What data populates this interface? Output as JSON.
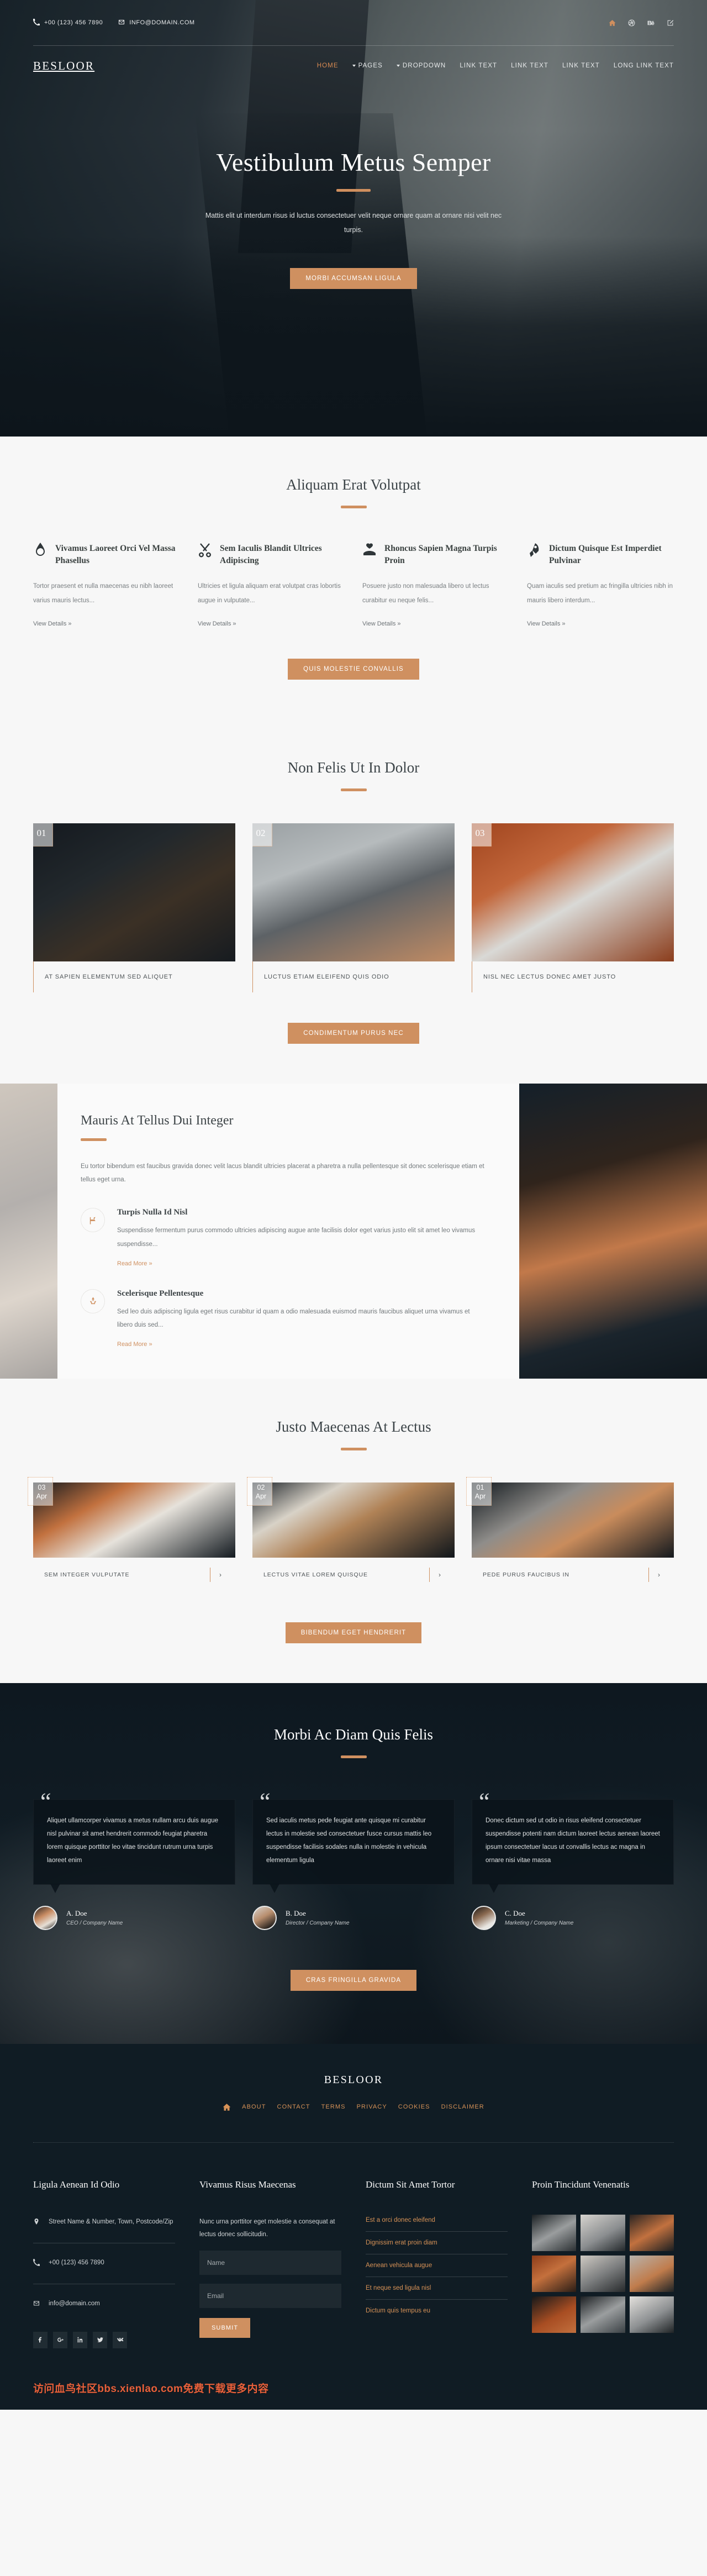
{
  "topbar": {
    "phone": "+00 (123) 456 7890",
    "email": "INFO@DOMAIN.COM",
    "socials": [
      "home-icon",
      "dribbble-icon",
      "behance-icon",
      "edit-icon"
    ]
  },
  "header": {
    "brand": "BESLOOR",
    "nav": [
      {
        "label": "HOME",
        "active": true,
        "caret": false
      },
      {
        "label": "PAGES",
        "active": false,
        "caret": true
      },
      {
        "label": "DROPDOWN",
        "active": false,
        "caret": true
      },
      {
        "label": "LINK TEXT",
        "active": false,
        "caret": false
      },
      {
        "label": "LINK TEXT",
        "active": false,
        "caret": false
      },
      {
        "label": "LINK TEXT",
        "active": false,
        "caret": false
      },
      {
        "label": "LONG LINK TEXT",
        "active": false,
        "caret": false
      }
    ]
  },
  "hero": {
    "title": "Vestibulum Metus Semper",
    "subtitle": "Mattis elit ut interdum risus id luctus consectetuer velit neque ornare quam at ornare nisi velit nec turpis.",
    "cta": "MORBI ACCUMSAN LIGULA"
  },
  "services": {
    "title": "Aliquam Erat Volutpat",
    "cta": "QUIS MOLESTIE CONVALLIS",
    "items": [
      {
        "icon": "pen-nib-icon",
        "title": "Vivamus Laoreet Orci Vel Massa Phasellus",
        "text": "Tortor praesent et nulla maecenas eu nibh laoreet varius mauris lectus...",
        "link": "View Details »"
      },
      {
        "icon": "scissors-icon",
        "title": "Sem Iaculis Blandit Ultrices Adipiscing",
        "text": "Ultricies et ligula aliquam erat volutpat cras lobortis augue in vulputate...",
        "link": "View Details »"
      },
      {
        "icon": "heart-hand-icon",
        "title": "Rhoncus Sapien Magna Turpis Proin",
        "text": "Posuere justo non malesuada libero ut lectus curabitur eu neque felis...",
        "link": "View Details »"
      },
      {
        "icon": "rocket-icon",
        "title": "Dictum Quisque Est Imperdiet Pulvinar",
        "text": "Quam iaculis sed pretium ac fringilla ultricies nibh in mauris libero interdum...",
        "link": "View Details »"
      }
    ]
  },
  "portfolio": {
    "title": "Non Felis Ut In Dolor",
    "cta": "CONDIMENTUM PURUS NEC",
    "items": [
      {
        "number": "01",
        "caption": "AT SAPIEN ELEMENTUM SED ALIQUET"
      },
      {
        "number": "02",
        "caption": "LUCTUS ETIAM ELEIFEND QUIS ODIO"
      },
      {
        "number": "03",
        "caption": "NISL NEC LECTUS DONEC AMET JUSTO"
      }
    ]
  },
  "feature": {
    "title": "Mauris At Tellus Dui Integer",
    "text": "Eu tortor bibendum est faucibus gravida donec velit lacus blandit ultricies placerat a pharetra a nulla pellentesque sit donec scelerisque etiam et tellus eget urna.",
    "items": [
      {
        "icon": "flag-icon",
        "title": "Turpis Nulla Id Nisl",
        "text": "Suspendisse fermentum purus commodo ultricies adipiscing augue ante facilisis dolor eget varius justo elit sit amet leo vivamus suspendisse...",
        "link": "Read More »"
      },
      {
        "icon": "recycle-icon",
        "title": "Scelerisque Pellentesque",
        "text": "Sed leo duis adipiscing ligula eget risus curabitur id quam a odio malesuada euismod mauris faucibus aliquet urna vivamus et libero duis sed...",
        "link": "Read More »"
      }
    ]
  },
  "blog": {
    "title": "Justo Maecenas At Lectus",
    "cta": "BIBENDUM EGET HENDRERIT",
    "items": [
      {
        "day": "03",
        "month": "Apr",
        "caption": "SEM INTEGER VULPUTATE",
        "arrow": "›"
      },
      {
        "day": "02",
        "month": "Apr",
        "caption": "LECTUS VITAE LOREM QUISQUE",
        "arrow": "›"
      },
      {
        "day": "01",
        "month": "Apr",
        "caption": "PEDE PURUS FAUCIBUS IN",
        "arrow": "›"
      }
    ]
  },
  "testimonials": {
    "title": "Morbi Ac Diam Quis Felis",
    "cta": "CRAS FRINGILLA GRAVIDA",
    "items": [
      {
        "quote": "Aliquet ullamcorper vivamus a metus nullam arcu duis augue nisl pulvinar sit amet hendrerit commodo feugiat pharetra lorem quisque porttitor leo vitae tincidunt rutrum urna turpis laoreet enim",
        "name": "A. Doe",
        "role": "CEO / Company Name"
      },
      {
        "quote": "Sed iaculis metus pede feugiat ante quisque mi curabitur lectus in molestie sed consectetuer fusce cursus mattis leo suspendisse facilisis sodales nulla in molestie in vehicula elementum ligula",
        "name": "B. Doe",
        "role": "Director / Company Name"
      },
      {
        "quote": "Donec dictum sed ut odio in risus eleifend consectetuer suspendisse potenti nam dictum laoreet lectus aenean laoreet ipsum consectetuer lacus ut convallis lectus ac magna in ornare nisi vitae massa",
        "name": "C. Doe",
        "role": "Marketing / Company Name"
      }
    ]
  },
  "footer": {
    "brand": "BESLOOR",
    "nav": [
      "ABOUT",
      "CONTACT",
      "TERMS",
      "PRIVACY",
      "COOKIES",
      "DISCLAIMER"
    ],
    "col1": {
      "title": "Ligula Aenean Id Odio",
      "address": "Street Name & Number, Town, Postcode/Zip",
      "phone": "+00 (123) 456 7890",
      "email": "info@domain.com",
      "socials": [
        "facebook-icon",
        "google-plus-icon",
        "linkedin-icon",
        "twitter-icon",
        "vk-icon"
      ]
    },
    "col2": {
      "title": "Vivamus Risus Maecenas",
      "text": "Nunc urna porttitor eget molestie a consequat at lectus donec sollicitudin.",
      "name_placeholder": "Name",
      "email_placeholder": "Email",
      "submit": "SUBMIT"
    },
    "col3": {
      "title": "Dictum Sit Amet Tortor",
      "links": [
        "Est a orci donec eleifend",
        "Dignissim erat proin diam",
        "Aenean vehicula augue",
        "Et neque sed ligula nisl",
        "Dictum quis tempus eu"
      ]
    },
    "col4": {
      "title": "Proin Tincidunt Venenatis"
    },
    "watermark": "访问血鸟社区bbs.xienlao.com免费下载更多内容"
  },
  "colors": {
    "accent": "#cf9060",
    "dark": "#101c24",
    "heading": "#3c4448"
  }
}
